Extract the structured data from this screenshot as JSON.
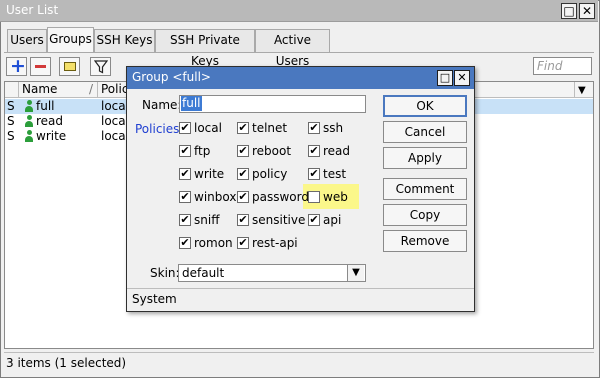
{
  "window": {
    "title": "User List",
    "restore_glyph": "□",
    "close_glyph": "✕"
  },
  "tabs": [
    {
      "label": "Users"
    },
    {
      "label": "Groups"
    },
    {
      "label": "SSH Keys"
    },
    {
      "label": "SSH Private Keys"
    },
    {
      "label": "Active Users"
    }
  ],
  "toolbar": {
    "add_glyph": "+",
    "find_placeholder": "Find",
    "menu_glyph": "▼"
  },
  "table": {
    "columns": [
      "Name",
      "Policie"
    ],
    "sort_glyph": "/",
    "rows": [
      {
        "flag": "S",
        "name": "full",
        "policies": "local t",
        "selected": true
      },
      {
        "flag": "S",
        "name": "read",
        "policies": "local t",
        "selected": false
      },
      {
        "flag": "S",
        "name": "write",
        "policies": "local t",
        "selected": false
      }
    ]
  },
  "status": "3 items (1 selected)",
  "dialog": {
    "title": "Group <full>",
    "restore_glyph": "□",
    "close_glyph": "✕",
    "name_label": "Name:",
    "name_value": "full",
    "policies_label": "Policies:",
    "check_glyph": "✔",
    "policies": [
      {
        "label": "local",
        "checked": true
      },
      {
        "label": "telnet",
        "checked": true
      },
      {
        "label": "ssh",
        "checked": true
      },
      {
        "label": "ftp",
        "checked": true
      },
      {
        "label": "reboot",
        "checked": true
      },
      {
        "label": "read",
        "checked": true
      },
      {
        "label": "write",
        "checked": true
      },
      {
        "label": "policy",
        "checked": true
      },
      {
        "label": "test",
        "checked": true
      },
      {
        "label": "winbox",
        "checked": true
      },
      {
        "label": "password",
        "checked": true
      },
      {
        "label": "web",
        "checked": false
      },
      {
        "label": "sniff",
        "checked": true
      },
      {
        "label": "sensitive",
        "checked": true
      },
      {
        "label": "api",
        "checked": true
      },
      {
        "label": "romon",
        "checked": true
      },
      {
        "label": "rest-api",
        "checked": true
      }
    ],
    "buttons": {
      "ok": "OK",
      "cancel": "Cancel",
      "apply": "Apply",
      "comment": "Comment",
      "copy": "Copy",
      "remove": "Remove"
    },
    "skin_label": "Skin:",
    "skin_value": "default",
    "skin_arrow_glyph": "▼",
    "status": "System"
  },
  "colors": {
    "dialog_title_bg": "#4a78bf",
    "selection": "#c8e1f7",
    "highlight": "#fbf78a",
    "label_blue": "#1f3fd1",
    "user_icon": "#2c9e3b",
    "add_icon": "#1f4fd6",
    "remove_icon": "#d23a3a"
  }
}
